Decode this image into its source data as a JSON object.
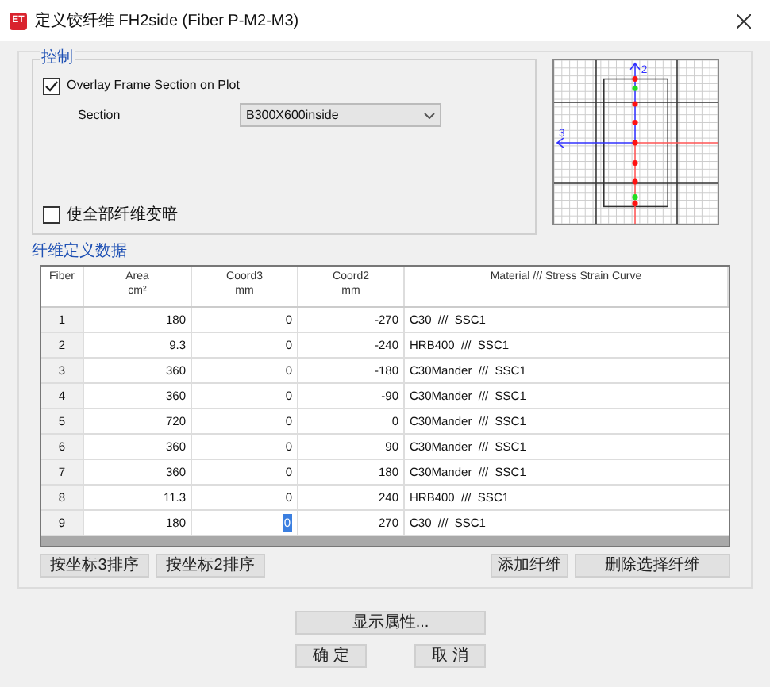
{
  "window": {
    "title": "定义铰纤维 FH2side  (Fiber P-M2-M3)",
    "icon": "ET"
  },
  "control": {
    "title": "控制",
    "overlay": {
      "label": "Overlay Frame Section on Plot",
      "checked": true
    },
    "section": {
      "label": "Section",
      "value": "B300X600inside"
    },
    "dim": {
      "label": "使全部纤维变暗",
      "checked": false
    }
  },
  "fibers": {
    "title": "纤维定义数据",
    "columns": [
      {
        "name": "Fiber"
      },
      {
        "name": "Area",
        "unit": "cm²"
      },
      {
        "name": "Coord3",
        "unit": "mm"
      },
      {
        "name": "Coord2",
        "unit": "mm"
      },
      {
        "name": "Material  ///  Stress Strain Curve"
      }
    ],
    "rows": [
      {
        "fiber": "1",
        "area": "180",
        "coord3": "0",
        "coord2": "-270",
        "material": "C30  ///  SSC1",
        "editing": false
      },
      {
        "fiber": "2",
        "area": "9.3",
        "coord3": "0",
        "coord2": "-240",
        "material": "HRB400  ///  SSC1",
        "editing": false
      },
      {
        "fiber": "3",
        "area": "360",
        "coord3": "0",
        "coord2": "-180",
        "material": "C30Mander  ///  SSC1",
        "editing": false
      },
      {
        "fiber": "4",
        "area": "360",
        "coord3": "0",
        "coord2": "-90",
        "material": "C30Mander  ///  SSC1",
        "editing": false
      },
      {
        "fiber": "5",
        "area": "720",
        "coord3": "0",
        "coord2": "0",
        "material": "C30Mander  ///  SSC1",
        "editing": false
      },
      {
        "fiber": "6",
        "area": "360",
        "coord3": "0",
        "coord2": "90",
        "material": "C30Mander  ///  SSC1",
        "editing": false
      },
      {
        "fiber": "7",
        "area": "360",
        "coord3": "0",
        "coord2": "180",
        "material": "C30Mander  ///  SSC1",
        "editing": false
      },
      {
        "fiber": "8",
        "area": "11.3",
        "coord3": "0",
        "coord2": "240",
        "material": "HRB400  ///  SSC1",
        "editing": false
      },
      {
        "fiber": "9",
        "area": "180",
        "coord3": "0",
        "coord2": "270",
        "material": "C30  ///  SSC1",
        "editing": true
      }
    ],
    "left_buttons": [
      "按坐标3排序",
      "按坐标2排序"
    ],
    "right_buttons": [
      "添加纤维",
      "删除选择纤维"
    ]
  },
  "plot": {
    "axis_2": "2",
    "axis_3": "3"
  },
  "show_properties": "显示属性...",
  "ok": "确 定",
  "cancel": "取 消"
}
